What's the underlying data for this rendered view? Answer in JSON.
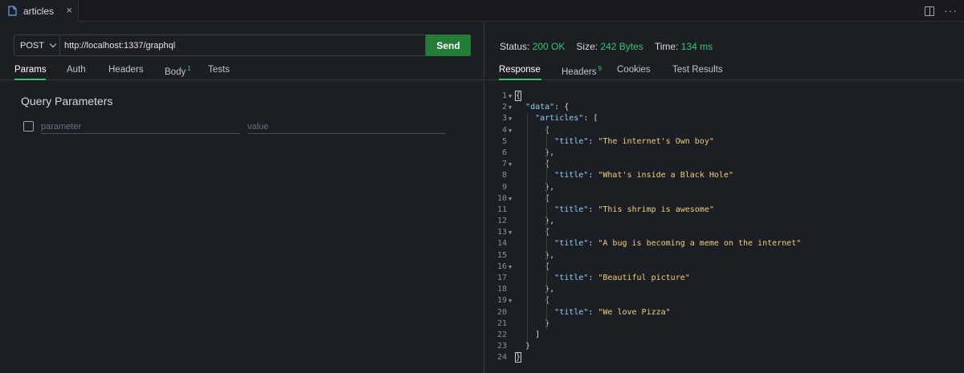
{
  "tab": {
    "label": "articles",
    "icon": "file-icon",
    "close": "×"
  },
  "toolbar": {
    "split_icon": "split-editor-icon",
    "more": "···"
  },
  "request": {
    "method": "POST",
    "url": "http://localhost:1337/graphql",
    "send_label": "Send",
    "tabs": [
      {
        "label": "Params",
        "badge": ""
      },
      {
        "label": "Auth",
        "badge": ""
      },
      {
        "label": "Headers",
        "badge": ""
      },
      {
        "label": "Body",
        "badge": "1"
      },
      {
        "label": "Tests",
        "badge": ""
      }
    ],
    "active_tab": "Params"
  },
  "query_params": {
    "title": "Query Parameters",
    "param_placeholder": "parameter",
    "value_placeholder": "value"
  },
  "response": {
    "status_label": "Status:",
    "status_value": "200 OK",
    "size_label": "Size:",
    "size_value": "242 Bytes",
    "time_label": "Time:",
    "time_value": "134 ms",
    "tabs": [
      {
        "label": "Response",
        "badge": ""
      },
      {
        "label": "Headers",
        "badge": "9"
      },
      {
        "label": "Cookies",
        "badge": ""
      },
      {
        "label": "Test Results",
        "badge": ""
      }
    ],
    "active_tab": "Response",
    "lines": [
      {
        "n": "1",
        "text": "{"
      },
      {
        "n": "2",
        "text": "  \"data\": {"
      },
      {
        "n": "3",
        "text": "    \"articles\": ["
      },
      {
        "n": "4",
        "text": "      {"
      },
      {
        "n": "5",
        "text": "        \"title\": \"The internet's Own boy\""
      },
      {
        "n": "6",
        "text": "      },"
      },
      {
        "n": "7",
        "text": "      {"
      },
      {
        "n": "8",
        "text": "        \"title\": \"What's inside a Black Hole\""
      },
      {
        "n": "9",
        "text": "      },"
      },
      {
        "n": "10",
        "text": "      {"
      },
      {
        "n": "11",
        "text": "        \"title\": \"This shrimp is awesome\""
      },
      {
        "n": "12",
        "text": "      },"
      },
      {
        "n": "13",
        "text": "      {"
      },
      {
        "n": "14",
        "text": "        \"title\": \"A bug is becoming a meme on the internet\""
      },
      {
        "n": "15",
        "text": "      },"
      },
      {
        "n": "16",
        "text": "      {"
      },
      {
        "n": "17",
        "text": "        \"title\": \"Beautiful picture\""
      },
      {
        "n": "18",
        "text": "      },"
      },
      {
        "n": "19",
        "text": "      {"
      },
      {
        "n": "20",
        "text": "        \"title\": \"We love Pizza\""
      },
      {
        "n": "21",
        "text": "      }"
      },
      {
        "n": "22",
        "text": "    ]"
      },
      {
        "n": "23",
        "text": "  }"
      },
      {
        "n": "24",
        "text": "}"
      }
    ]
  },
  "colors": {
    "accent_green": "#3cc46a",
    "send_button": "#237d38",
    "json_key": "#8fd0f5",
    "json_string": "#f2cd7a"
  }
}
